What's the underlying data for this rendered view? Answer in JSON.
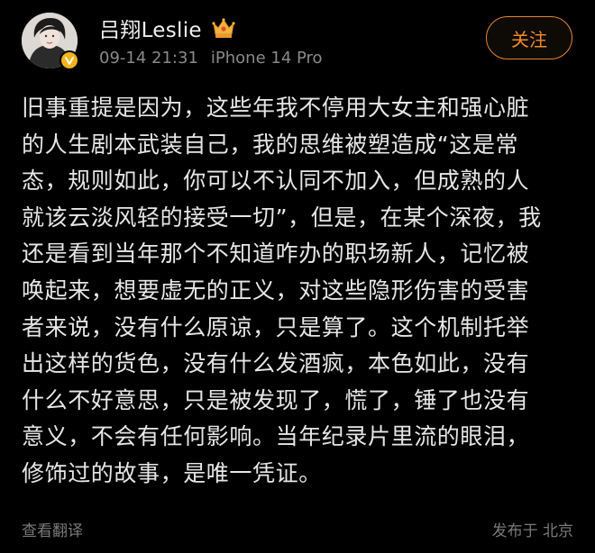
{
  "post": {
    "author": {
      "name": "吕翔Leslie",
      "verified_badge_color": "#f3b41b",
      "member_icon": "crown-icon"
    },
    "meta": {
      "time": "09-14 21:31",
      "device": "iPhone 14 Pro"
    },
    "follow_label": "关注",
    "content_lines": [
      "旧事重提是因为，这些年我不停用大女主和强心脏",
      "的人生剧本武装自己，我的思维被塑造成“这是常",
      "态，规则如此，你可以不认同不加入，但成熟的人",
      "就该云淡风轻的接受一切”，但是，在某个深夜，我",
      "还是看到当年那个不知道咋办的职场新人，记忆被",
      "唤起来，想要虚无的正义，对这些隐形伤害的受害",
      "者来说，没有什么原谅，只是算了。这个机制托举",
      "出这样的货色，没有什么发酒疯，本色如此，没有",
      "什么不好意思，只是被发现了，慌了，锤了也没有",
      "意义，不会有任何影响。当年纪录片里流的眼泪，",
      "修饰过的故事，是唯一凭证。"
    ],
    "translate_label": "查看翻译",
    "location_label": "发布于 北京"
  },
  "colors": {
    "background": "#000000",
    "accent": "#f08a2a"
  }
}
